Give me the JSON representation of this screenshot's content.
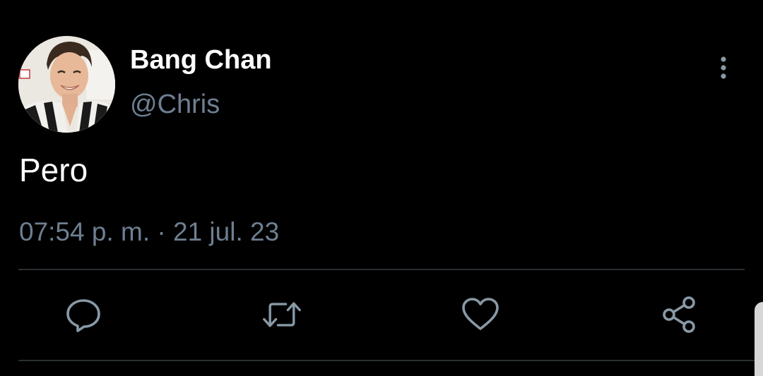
{
  "tweet": {
    "author": {
      "display_name": "Bang Chan",
      "handle": "@Chris"
    },
    "text": "Pero",
    "timestamp": "07:54 p. m. · 21 jul. 23"
  },
  "actions": {
    "reply_icon": "reply-bubble-icon",
    "retweet_icon": "retweet-icon",
    "like_icon": "heart-icon",
    "share_icon": "share-icon",
    "more_icon": "more-vertical-icon"
  },
  "colors": {
    "background": "#000000",
    "primary_text": "#ffffff",
    "secondary_text": "#6e7f91",
    "divider": "#2a2f34"
  }
}
